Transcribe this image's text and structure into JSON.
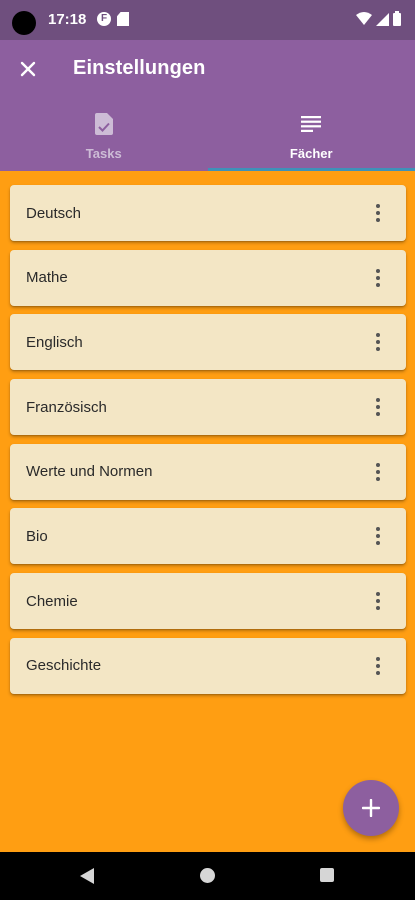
{
  "status_bar": {
    "time": "17:18",
    "app_icon_letter": "F",
    "icons": [
      "camera-dot",
      "notification-f-icon",
      "sd-card-icon",
      "wifi-icon",
      "signal-icon",
      "battery-icon"
    ]
  },
  "app_bar": {
    "title": "Einstellungen",
    "close_icon": "close-icon"
  },
  "tabs": [
    {
      "label": "Tasks",
      "icon": "task-document-icon",
      "active": false
    },
    {
      "label": "Fächer",
      "icon": "list-lines-icon",
      "active": true
    }
  ],
  "subjects": [
    {
      "label": "Deutsch"
    },
    {
      "label": "Mathe"
    },
    {
      "label": "Englisch"
    },
    {
      "label": "Französisch"
    },
    {
      "label": "Werte und Normen"
    },
    {
      "label": "Bio"
    },
    {
      "label": "Chemie"
    },
    {
      "label": "Geschichte"
    }
  ],
  "fab": {
    "icon": "add-icon",
    "symbol": "+"
  },
  "nav_bar": {
    "icons": [
      "back-triangle-icon",
      "home-circle-icon",
      "recents-square-icon"
    ]
  },
  "colors": {
    "background": "#ff9e12",
    "status_bar": "#6f4f7e",
    "app_bar": "#8d5f9f",
    "card": "#f3e6c5",
    "tab_indicator": "#3f91b8",
    "inactive_tab": "#cdbcd6"
  }
}
